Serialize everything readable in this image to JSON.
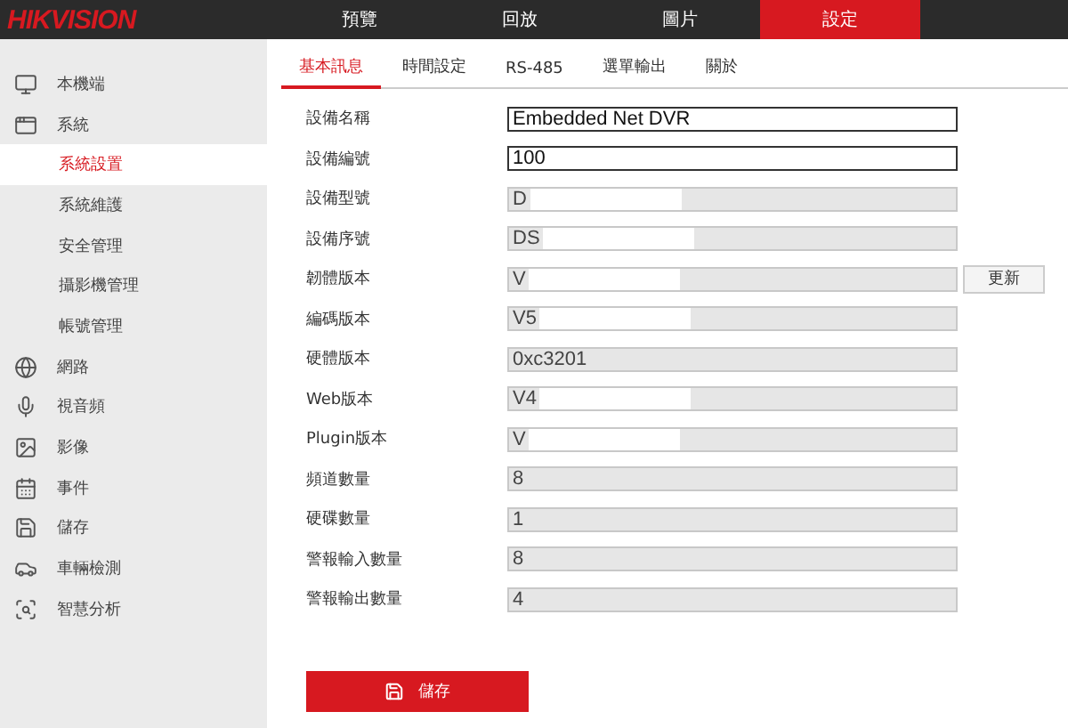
{
  "header": {
    "logo": "HIKVISION",
    "nav": [
      {
        "label": "預覽",
        "selected": false
      },
      {
        "label": "回放",
        "selected": false
      },
      {
        "label": "圖片",
        "selected": false
      },
      {
        "label": "設定",
        "selected": true
      }
    ]
  },
  "sidebar": {
    "items": [
      {
        "label": "本機端",
        "selected": false
      },
      {
        "label": "系統",
        "selected": false,
        "children": [
          {
            "label": "系統設置",
            "selected": true
          },
          {
            "label": "系統維護",
            "selected": false
          },
          {
            "label": "安全管理",
            "selected": false
          },
          {
            "label": "攝影機管理",
            "selected": false
          },
          {
            "label": "帳號管理",
            "selected": false
          }
        ]
      },
      {
        "label": "網路",
        "selected": false
      },
      {
        "label": "視音頻",
        "selected": false
      },
      {
        "label": "影像",
        "selected": false
      },
      {
        "label": "事件",
        "selected": false
      },
      {
        "label": "儲存",
        "selected": false
      },
      {
        "label": "車輛檢測",
        "selected": false
      },
      {
        "label": "智慧分析",
        "selected": false
      }
    ]
  },
  "tabs": [
    {
      "label": "基本訊息",
      "selected": true
    },
    {
      "label": "時間設定",
      "selected": false
    },
    {
      "label": "RS-485",
      "selected": false
    },
    {
      "label": "選單輸出",
      "selected": false
    },
    {
      "label": "關於",
      "selected": false
    }
  ],
  "fields": [
    {
      "label": "設備名稱",
      "value": "Embedded Net DVR",
      "disabled": false
    },
    {
      "label": "設備編號",
      "value": "100",
      "disabled": false
    },
    {
      "label": "設備型號",
      "value": "D",
      "disabled": true,
      "redacted": true
    },
    {
      "label": "設備序號",
      "value": "DS",
      "disabled": true,
      "redacted": true
    },
    {
      "label": "韌體版本",
      "value": "V",
      "disabled": true,
      "redacted": true,
      "button": "更新"
    },
    {
      "label": "編碼版本",
      "value": "V5",
      "disabled": true,
      "redacted": true
    },
    {
      "label": "硬體版本",
      "value": "0xc3201",
      "disabled": true
    },
    {
      "label": "Web版本",
      "value": "V4",
      "disabled": true,
      "redacted": true
    },
    {
      "label": "Plugin版本",
      "value": "V",
      "disabled": true,
      "redacted": true
    },
    {
      "label": "頻道數量",
      "value": "8",
      "disabled": true
    },
    {
      "label": "硬碟數量",
      "value": "1",
      "disabled": true
    },
    {
      "label": "警報輸入數量",
      "value": "8",
      "disabled": true
    },
    {
      "label": "警報輸出數量",
      "value": "4",
      "disabled": true
    }
  ],
  "save_button": "儲存"
}
